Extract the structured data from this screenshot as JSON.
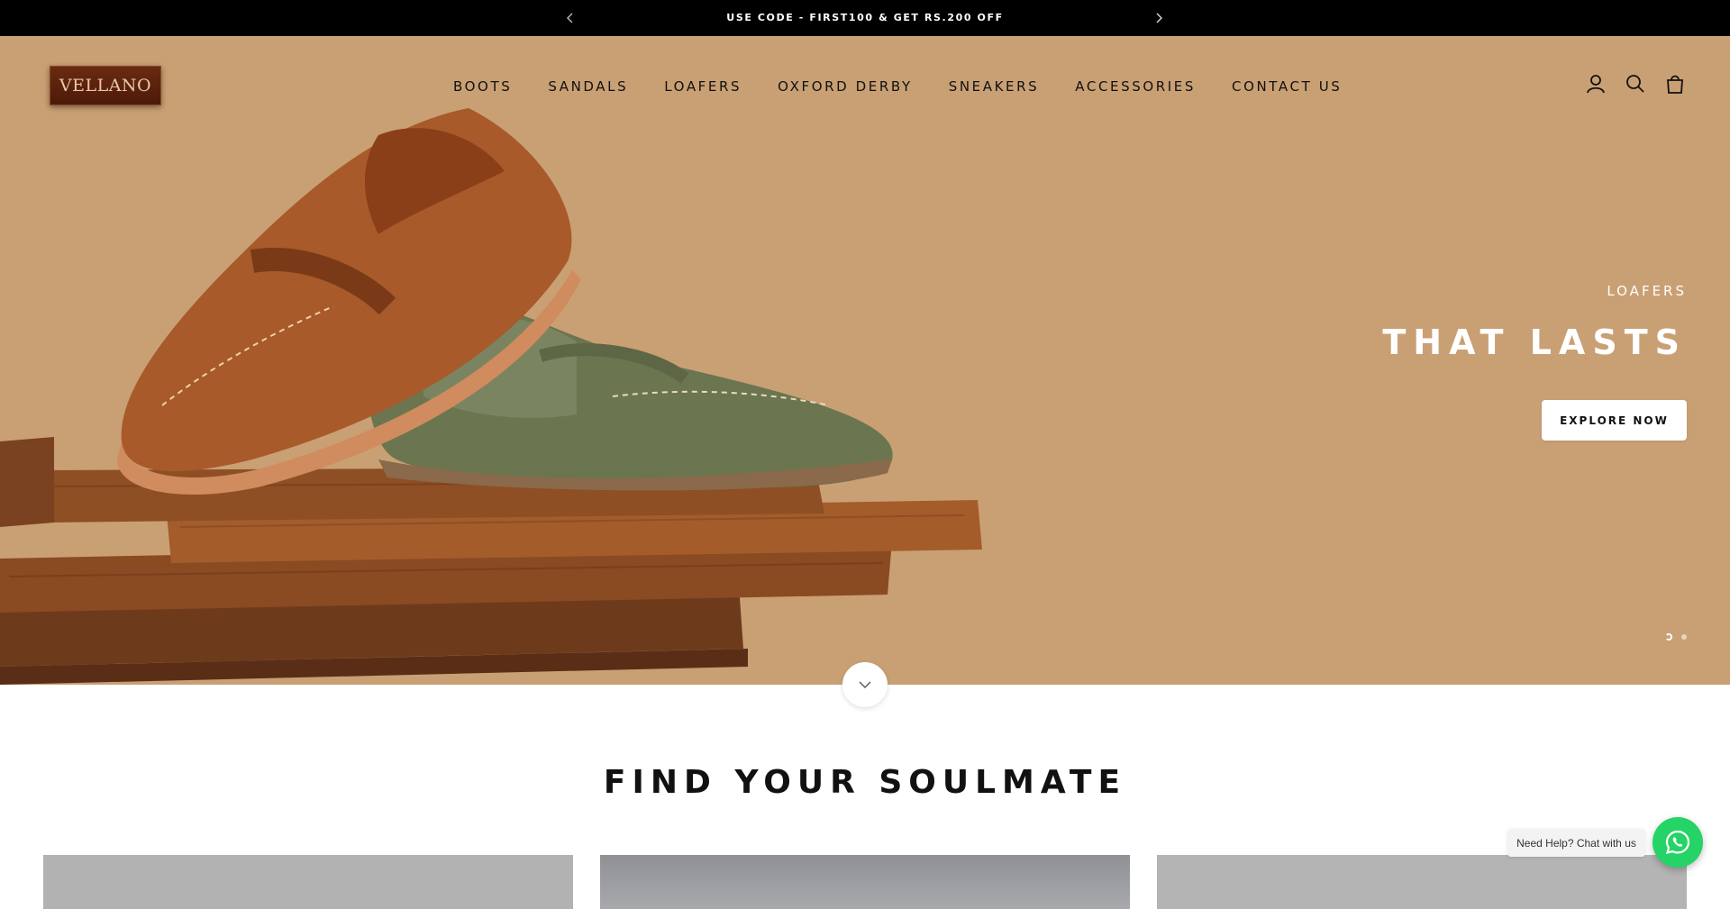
{
  "announcement": {
    "text": "USE CODE - FIRST100 & GET RS.200 OFF",
    "prev_icon": "chevron-left-icon",
    "next_icon": "chevron-right-icon"
  },
  "header": {
    "logo_text": "VELLANO",
    "nav": [
      "BOOTS",
      "SANDALS",
      "LOAFERS",
      "OXFORD DERBY",
      "SNEAKERS",
      "ACCESSORIES",
      "CONTACT US"
    ],
    "icons": [
      "account-icon",
      "search-icon",
      "cart-icon"
    ]
  },
  "hero": {
    "subheading": "LOAFERS",
    "heading": "THAT LASTS",
    "button_label": "EXPLORE NOW",
    "background_color": "#c9a074",
    "slides_total": 2,
    "active_slide": 1
  },
  "section": {
    "title": "FIND YOUR SOULMATE"
  },
  "whatsapp": {
    "label": "Need Help? Chat with us",
    "color": "#25d366",
    "icon": "whatsapp-icon"
  }
}
